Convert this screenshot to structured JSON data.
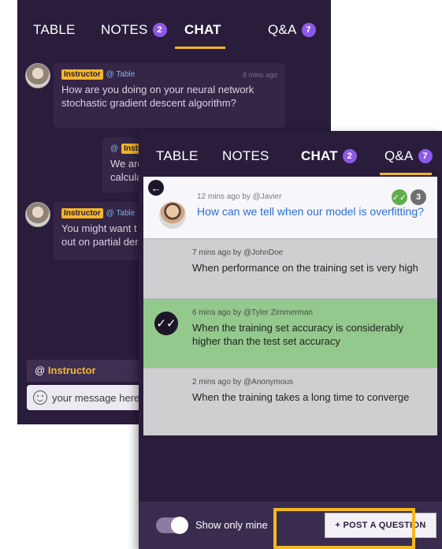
{
  "back": {
    "tabs": [
      {
        "label": "TABLE"
      },
      {
        "label": "NOTES",
        "count": "2"
      },
      {
        "label": "CHAT"
      },
      {
        "label": "Q&A",
        "count": "7"
      }
    ],
    "messages": [
      {
        "role": "Instructor",
        "mention": "@ Table",
        "time": "8 mins ago",
        "text": "How are you doing on your neural network stochastic gradient descent algorithm?"
      },
      {
        "role": "Instru",
        "mention": "@",
        "text": "We are calcula"
      },
      {
        "role": "Instructor",
        "mention": "@ Table",
        "text": "You might want t out on partial der"
      }
    ],
    "reply_to_prefix": "@",
    "reply_to_name": "Instructor",
    "input_placeholder": "your message here"
  },
  "front": {
    "tabs": [
      {
        "label": "TABLE"
      },
      {
        "label": "NOTES"
      },
      {
        "label": "CHAT",
        "count": "2"
      },
      {
        "label": "Q&A",
        "count": "7"
      }
    ],
    "question": {
      "meta": "12 mins ago by @Javier",
      "title": "How can we tell when our model is overfitting?",
      "answer_count": "3",
      "check": "✓✓"
    },
    "answers": [
      {
        "meta": "7 mins ago by @JohnDoe",
        "text": "When performance on the training set is very high"
      },
      {
        "meta": "6 mins ago by @Tyler Zimmerman",
        "text": "When the training set accuracy is considerably higher than the test set accuracy"
      },
      {
        "meta": "2 mins ago by @Anonymous",
        "text": "When the training takes a long time to converge"
      }
    ],
    "show_only_mine": "Show only mine",
    "post_question": "+ POST A QUESTION"
  },
  "colors": {
    "purple_dark": "#2a1d3c",
    "accent_yellow": "#f3b628",
    "badge_purple": "#8d59e8",
    "accepted_green": "#93c98c"
  }
}
